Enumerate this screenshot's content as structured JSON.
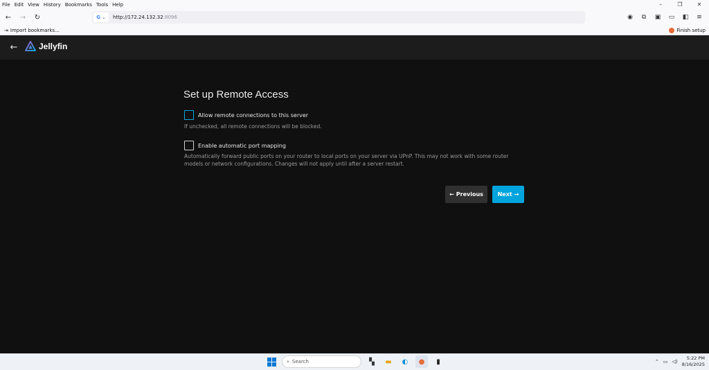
{
  "browser": {
    "menu": [
      "File",
      "Edit",
      "View",
      "History",
      "Bookmarks",
      "Tools",
      "Help"
    ],
    "url_host": "http://172.24.132.32",
    "url_port": ":8096",
    "bookmarks": {
      "import_label": "Import bookmarks...",
      "finish_label": "Finish setup"
    }
  },
  "jellyfin": {
    "logo_text": "Jellyfin"
  },
  "page": {
    "title": "Set up Remote Access",
    "remote": {
      "label": "Allow remote connections to this server",
      "description": "If unchecked, all remote connections will be blocked.",
      "checked": false
    },
    "upnp": {
      "label": "Enable automatic port mapping",
      "description": "Automatically forward public ports on your router to local ports on your server via UPnP. This may not work with some router models or network configurations. Changes will not apply until after a server restart.",
      "checked": false
    },
    "previous_label": "Previous",
    "next_label": "Next"
  },
  "taskbar": {
    "search_placeholder": "Search",
    "time": "5:22 PM",
    "date": "8/16/2025"
  },
  "colors": {
    "accent": "#00a4dc",
    "background": "#101010",
    "header": "#1c1c1c"
  }
}
